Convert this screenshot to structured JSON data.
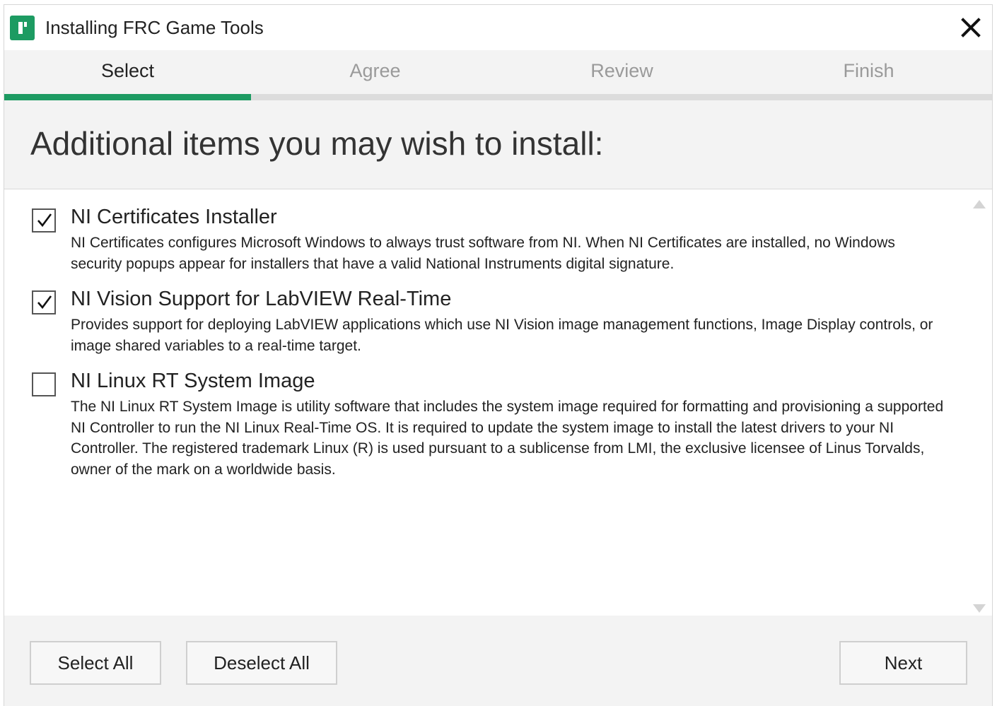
{
  "window": {
    "title": "Installing FRC Game Tools",
    "logo_icon": "ni-logo-icon",
    "close_icon": "close-icon"
  },
  "steps": {
    "items": [
      {
        "label": "Select",
        "active": true
      },
      {
        "label": "Agree",
        "active": false
      },
      {
        "label": "Review",
        "active": false
      },
      {
        "label": "Finish",
        "active": false
      }
    ],
    "progress_fraction": 0.25,
    "accent_color": "#1d9b62"
  },
  "heading": "Additional items you may wish to install:",
  "items": [
    {
      "title": "NI Certificates Installer",
      "description": "NI Certificates configures Microsoft Windows to always trust software from NI. When NI Certificates are installed, no Windows security popups appear for installers that have a valid National Instruments digital signature.",
      "checked": true
    },
    {
      "title": "NI Vision Support for LabVIEW Real-Time",
      "description": "Provides support for deploying LabVIEW applications which use NI Vision image management functions, Image Display controls, or image shared variables to a real-time target.",
      "checked": true
    },
    {
      "title": "NI Linux RT System Image",
      "description": "The NI Linux RT System Image is utility software that includes the system image required for formatting and provisioning a supported NI Controller to run the NI Linux Real-Time OS. It is required to update the system image to install the latest drivers to your NI Controller. The registered trademark Linux (R) is used pursuant to a sublicense from LMI, the exclusive licensee of Linus Torvalds, owner of the mark on a worldwide basis.",
      "checked": false
    }
  ],
  "footer": {
    "select_all": "Select All",
    "deselect_all": "Deselect All",
    "next": "Next"
  }
}
